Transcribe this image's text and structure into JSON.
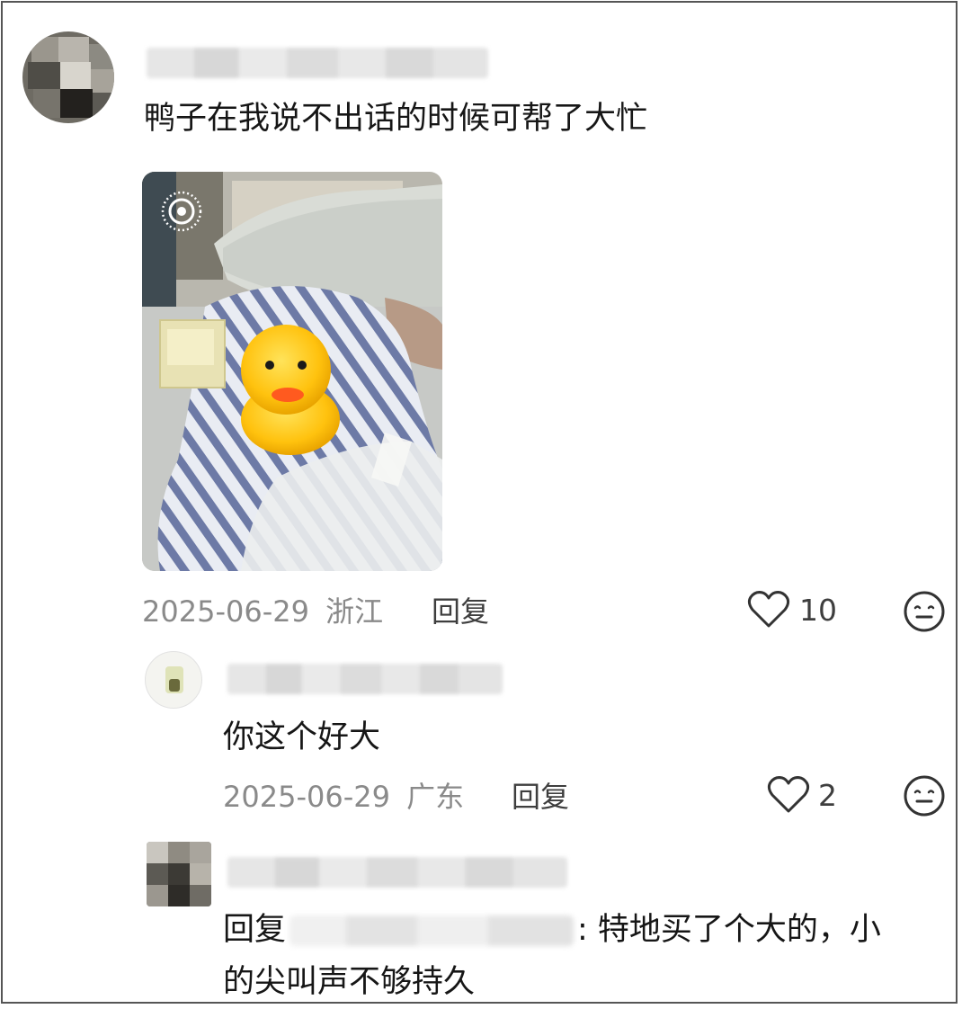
{
  "comments": [
    {
      "text": "鸭子在我说不出话的时候可帮了大忙",
      "date": "2025-06-29",
      "location": "浙江",
      "reply_label": "回复",
      "likes": "10"
    },
    {
      "text": "你这个好大",
      "date": "2025-06-29",
      "location": "广东",
      "reply_label": "回复",
      "likes": "2"
    },
    {
      "reply_prefix": "回复",
      "text_line1": ": 特地买了个大的，小",
      "text_line2": "的尖叫声不够持久"
    }
  ],
  "icons": {
    "like": "heart-outline-icon",
    "reaction": "neutral-face-icon",
    "live_photo": "live-photo-icon"
  },
  "colors": {
    "text": "#161616",
    "meta": "#8a8a8a",
    "duck": "#ffcc1a",
    "beak": "#ff5a1f"
  }
}
